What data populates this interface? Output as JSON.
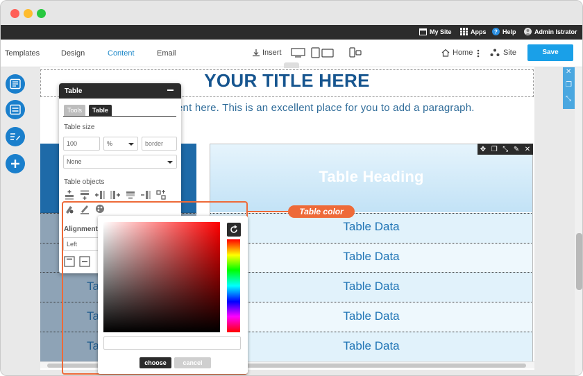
{
  "adminbar": {
    "my_site": "My Site",
    "apps": "Apps",
    "help": "Help",
    "user": "Admin Istrator",
    "icons": [
      "calendar-icon",
      "grid-icon",
      "help-icon",
      "user-avatar-icon"
    ]
  },
  "toolbar": {
    "tabs": [
      "Templates",
      "Design",
      "Content",
      "Email"
    ],
    "active_tab": "Content",
    "insert": "Insert",
    "home": "Home",
    "site": "Site",
    "save_label": "Save"
  },
  "page": {
    "title": "YOUR TITLE HERE",
    "paragraph": "ent here. This is an excellent place for you to add a paragraph."
  },
  "table": {
    "heading": "Table Heading",
    "data": [
      "Table Data",
      "Table Data",
      "Table Data",
      "Table Data",
      "Table Data"
    ],
    "left_column_partial": [
      "Ta",
      "Ta",
      "Ta",
      "Ta",
      "Ta"
    ]
  },
  "panel": {
    "title": "Table",
    "tabs": [
      "Tools",
      "Table"
    ],
    "table_size_label": "Table size",
    "width_value": "100",
    "unit_value": "%",
    "border_placeholder": "border",
    "style_value": "None",
    "table_objects_label": "Table objects",
    "alignment_label": "Alignment",
    "alignment_value": "Left"
  },
  "color_picker": {
    "callout": "Table color",
    "choose_label": "choose",
    "cancel_label": "cancel",
    "hex_value": ""
  },
  "colors": {
    "accent": "#1aa0e8",
    "callout": "#ee6a38",
    "title": "#16558f",
    "table_text": "#1f74b5",
    "dark": "#2b2b2b"
  }
}
